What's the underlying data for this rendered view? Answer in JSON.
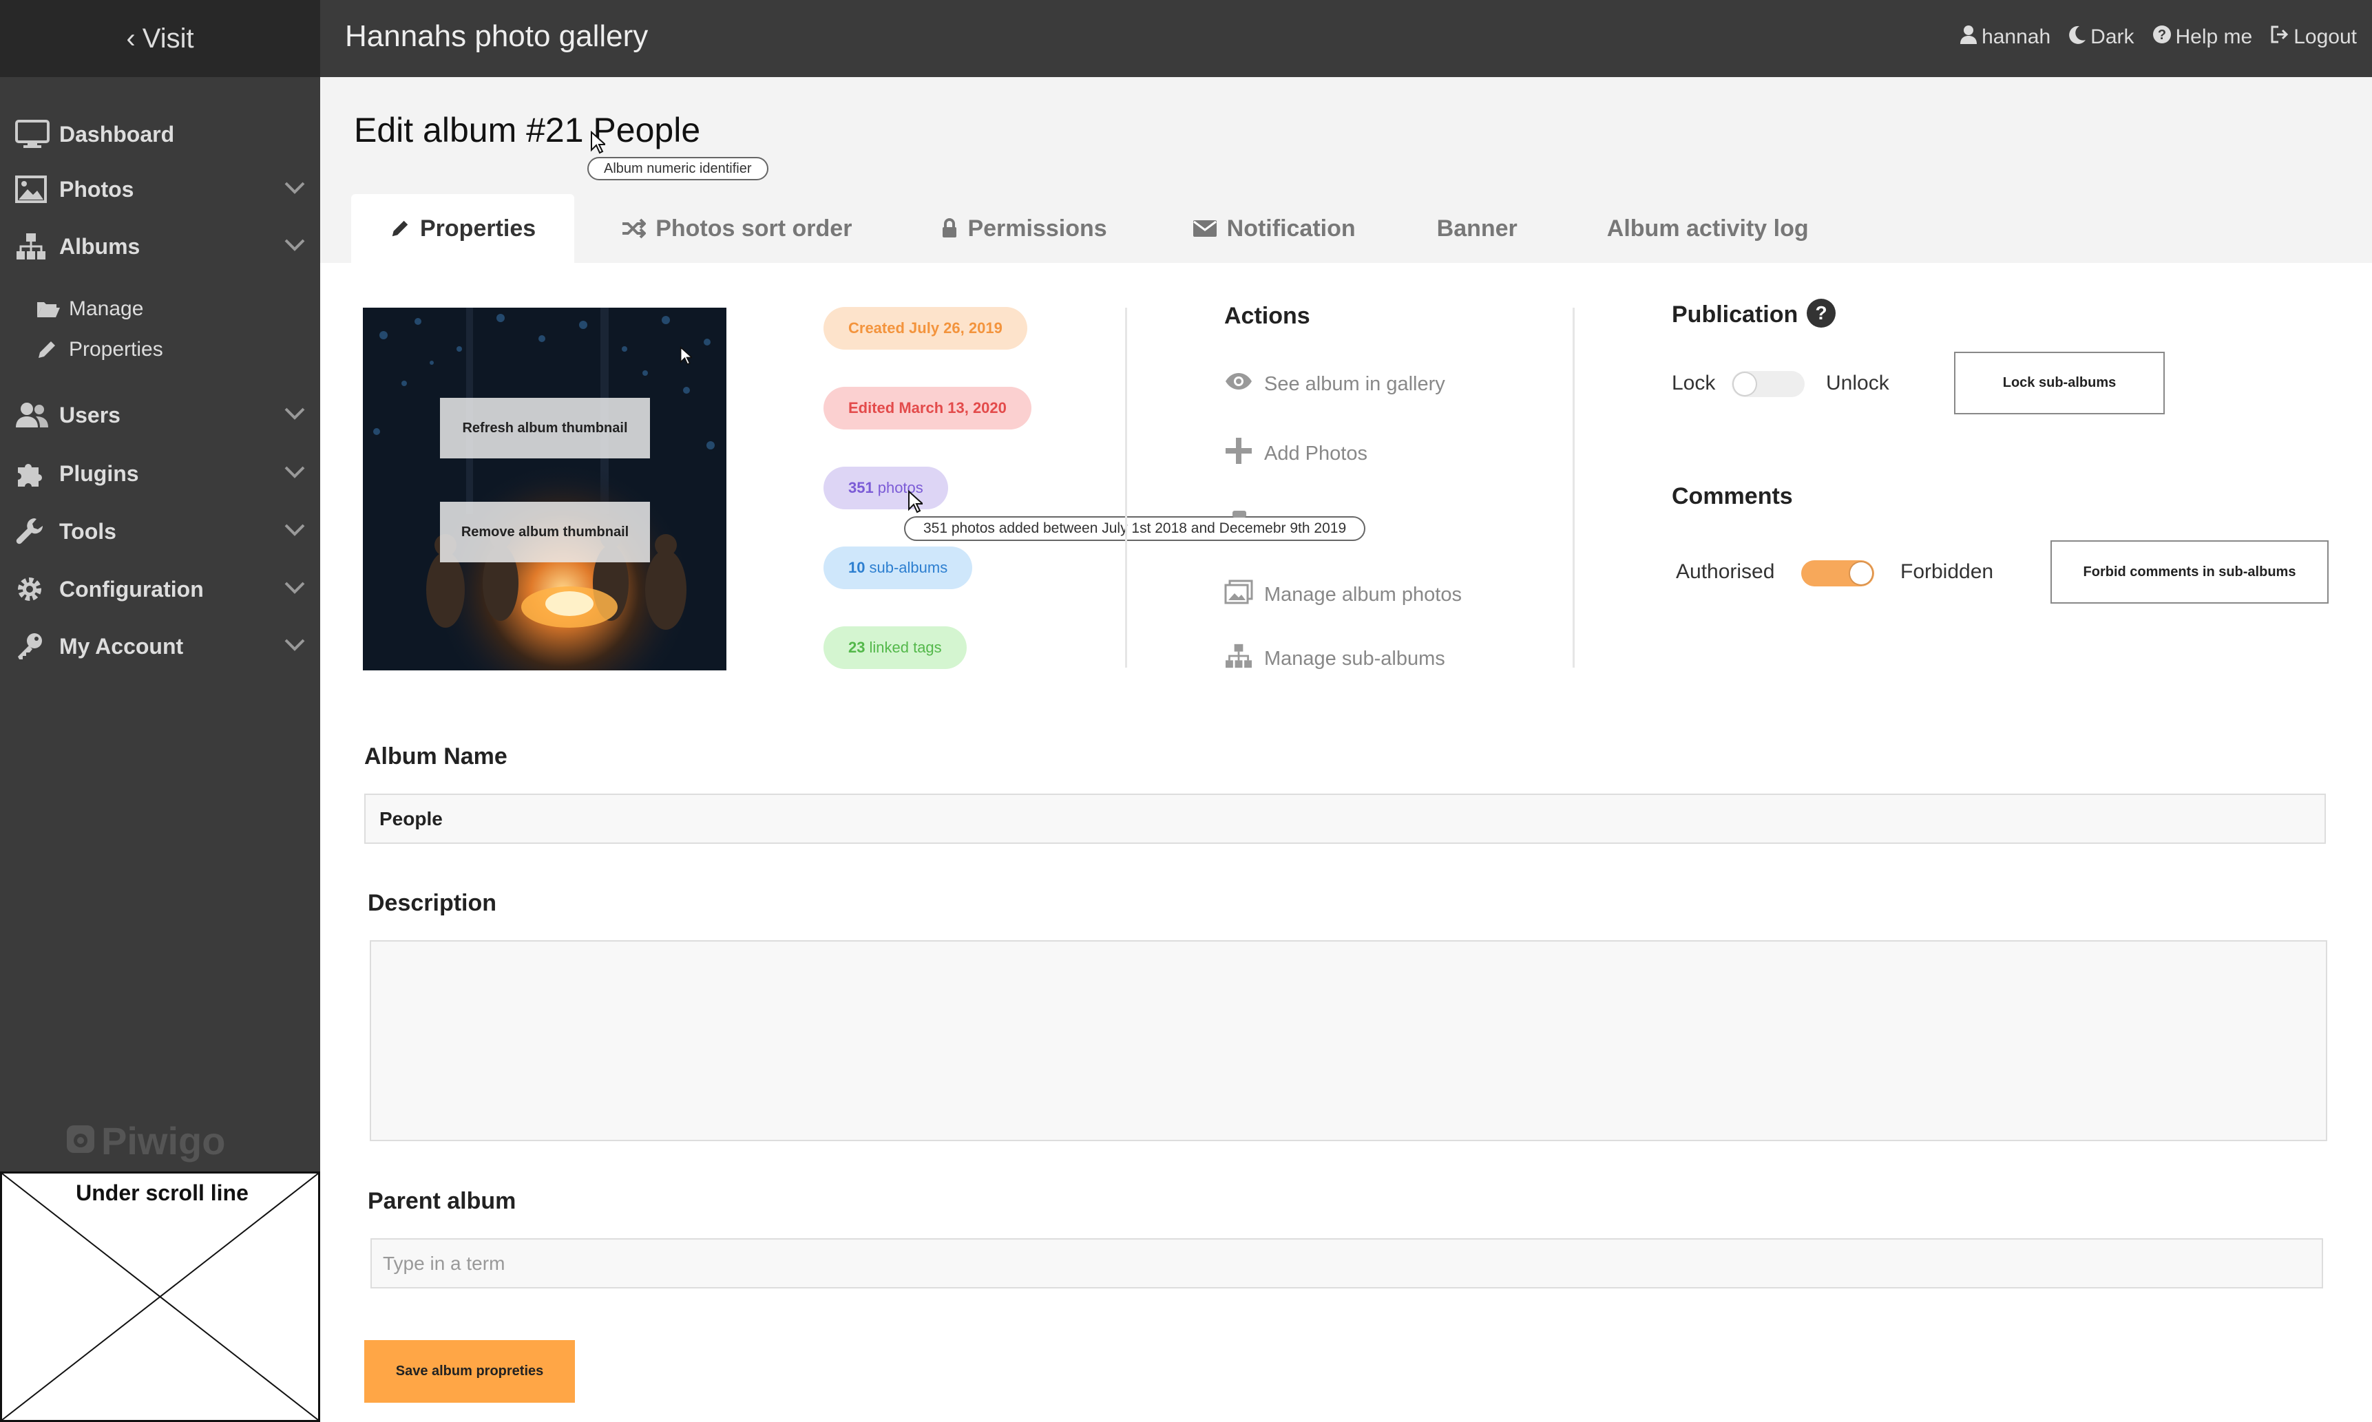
{
  "sidebar": {
    "visit": "Visit",
    "items": [
      {
        "label": "Dashboard",
        "icon": "monitor-icon"
      },
      {
        "label": "Photos",
        "icon": "image-icon"
      },
      {
        "label": "Albums",
        "icon": "sitemap-icon"
      },
      {
        "label": "Users",
        "icon": "users-icon"
      },
      {
        "label": "Plugins",
        "icon": "puzzle-icon"
      },
      {
        "label": "Tools",
        "icon": "wrench-icon"
      },
      {
        "label": "Configuration",
        "icon": "gear-icon"
      },
      {
        "label": "My Account",
        "icon": "key-icon"
      }
    ],
    "albums_sub": [
      {
        "label": "Manage",
        "icon": "folder-open-icon"
      },
      {
        "label": "Properties",
        "icon": "pencil-icon"
      }
    ],
    "brand": "Piwigo"
  },
  "under_scroll": "Under scroll line",
  "header": {
    "title": "Hannahs photo gallery",
    "user": "hannah",
    "theme": "Dark",
    "help": "Help me",
    "logout": "Logout"
  },
  "page": {
    "title": "Edit album #21 People",
    "title_tooltip": "Album numeric identifier"
  },
  "tabs": [
    "Properties",
    "Photos sort order",
    "Permissions",
    "Notification",
    "Banner",
    "Album activity log"
  ],
  "thumbnail": {
    "refresh": "Refresh album thumbnail",
    "remove": "Remove album thumbnail"
  },
  "stats": {
    "created": "Created July 26, 2019",
    "edited": "Edited March 13, 2020",
    "photos_count": "351",
    "photos_label": "photos",
    "photos_tooltip": "351 photos added between July 1st 2018 and Decemebr 9th 2019",
    "subalbums_count": "10",
    "subalbums_label": "sub-albums",
    "tags_count": "23",
    "tags_label": "linked tags"
  },
  "actions": {
    "title": "Actions",
    "items": [
      "See album in gallery",
      "Add Photos",
      "Manage album photos",
      "Manage sub-albums"
    ]
  },
  "publication": {
    "title": "Publication",
    "lock": "Lock",
    "unlock": "Unlock",
    "lock_sub": "Lock sub-albums"
  },
  "comments": {
    "title": "Comments",
    "authorised": "Authorised",
    "forbidden": "Forbidden",
    "forbid_sub": "Forbid comments in sub-albums"
  },
  "form": {
    "name_label": "Album Name",
    "name_value": "People",
    "description_label": "Description",
    "description_value": "",
    "parent_label": "Parent album",
    "parent_placeholder": "Type in a term",
    "save": "Save album propreties"
  },
  "colors": {
    "sidebar": "#3b3b3b",
    "header": "#3b3b3b",
    "accent": "#ffa646"
  }
}
